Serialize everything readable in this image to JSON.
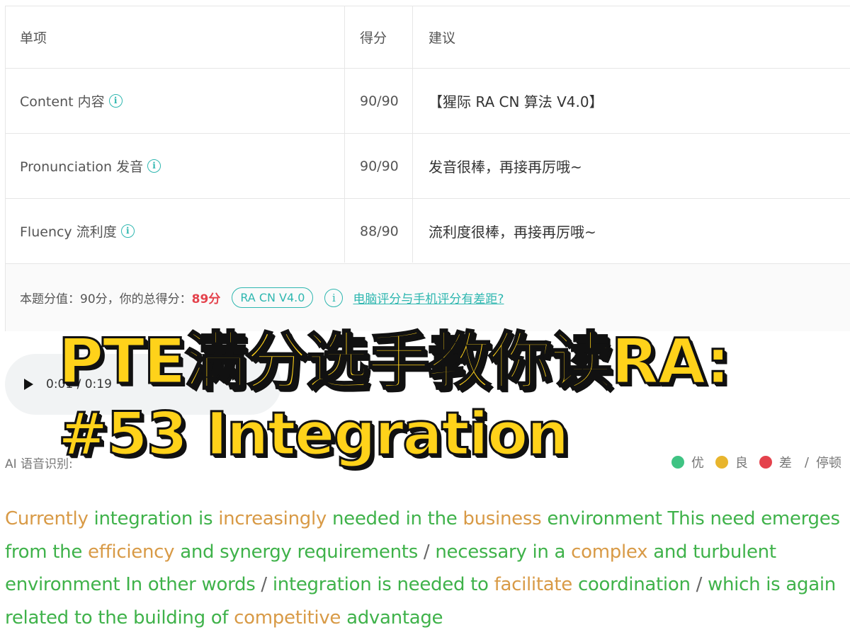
{
  "table": {
    "headers": {
      "item": "单项",
      "score": "得分",
      "advice": "建议"
    },
    "rows": [
      {
        "item": "Content 内容",
        "score": "90/90",
        "advice": "【猩际 RA CN 算法 V4.0】"
      },
      {
        "item": "Pronunciation 发音",
        "score": "90/90",
        "advice": "发音很棒，再接再厉哦~"
      },
      {
        "item": "Fluency 流利度",
        "score": "88/90",
        "advice": "流利度很棒，再接再厉哦~"
      }
    ],
    "info_glyph": "i"
  },
  "total": {
    "label": "本题分值：90分，你的总得分：",
    "score": "89分",
    "algorithm_badge": "RA CN V4.0",
    "info_glyph": "i",
    "diff_link": "电脑评分与手机评分有差距?"
  },
  "audio": {
    "time": "0:01 / 0:19",
    "play_icon": "play-icon"
  },
  "ai": {
    "label": "AI 语音识别:",
    "legend": {
      "good": "优",
      "ok": "良",
      "bad": "差",
      "separator": "/",
      "pause": "停顿"
    },
    "colors": {
      "good": "#3fc383",
      "ok": "#e8b52d",
      "bad": "#e4424c"
    }
  },
  "transcript": {
    "words": [
      {
        "t": "Currently",
        "c": "o"
      },
      {
        "t": "integration is",
        "c": "g"
      },
      {
        "t": "increasingly",
        "c": "o"
      },
      {
        "t": "needed in the",
        "c": "g"
      },
      {
        "t": "business",
        "c": "o"
      },
      {
        "t": "environment This need emerges from the",
        "c": "g"
      },
      {
        "t": "efficiency",
        "c": "o"
      },
      {
        "t": "and synergy requirements",
        "c": "g"
      },
      {
        "t": "/",
        "c": "s"
      },
      {
        "t": "necessary in a",
        "c": "g"
      },
      {
        "t": "complex",
        "c": "o"
      },
      {
        "t": "and turbulent environment In other words",
        "c": "g"
      },
      {
        "t": "/",
        "c": "s"
      },
      {
        "t": "integration is needed to",
        "c": "g"
      },
      {
        "t": "facilitate",
        "c": "o"
      },
      {
        "t": "coordination",
        "c": "g"
      },
      {
        "t": "/",
        "c": "s"
      },
      {
        "t": "which is again related to the building of",
        "c": "g"
      },
      {
        "t": "competitive",
        "c": "o"
      },
      {
        "t": "advantage",
        "c": "g"
      }
    ]
  },
  "overlay": {
    "line1": "PTE满分选手教你读RA:",
    "line2": "#53 Integration",
    "color": "#ffd21a"
  }
}
